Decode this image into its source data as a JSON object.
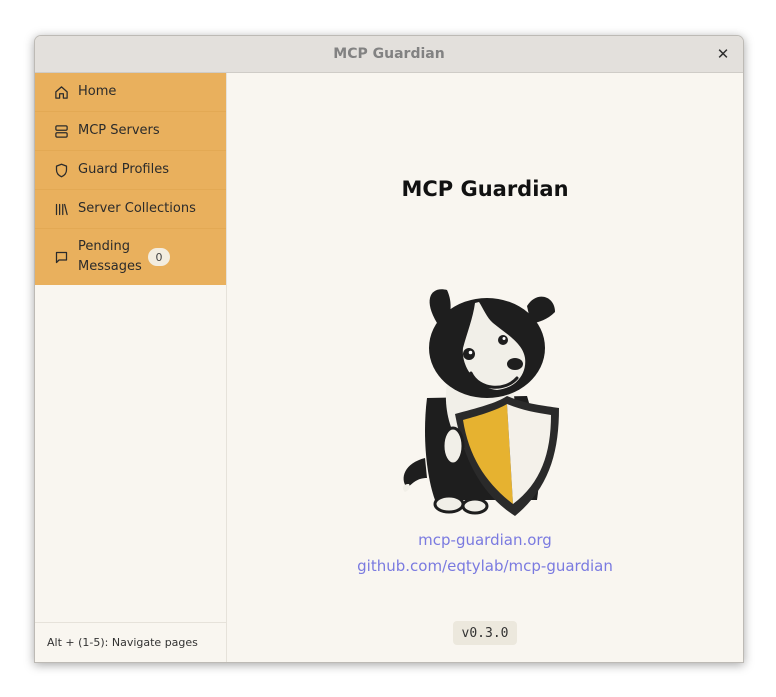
{
  "window": {
    "title": "MCP Guardian",
    "close_glyph": "✕"
  },
  "sidebar": {
    "items": [
      {
        "label": "Home",
        "icon": "home-icon"
      },
      {
        "label": "MCP Servers",
        "icon": "server-icon"
      },
      {
        "label": "Guard Profiles",
        "icon": "shield-icon"
      },
      {
        "label": "Server Collections",
        "icon": "library-icon"
      },
      {
        "label": "Pending Messages",
        "icon": "message-icon",
        "badge": "0"
      }
    ],
    "footer": "Alt + (1-5): Navigate pages"
  },
  "main": {
    "heading": "MCP Guardian",
    "mascot": "border-collie-with-shield",
    "website_link": "mcp-guardian.org",
    "github_link": "github.com/eqtylab/mcp-guardian",
    "version": "v0.3.0"
  },
  "colors": {
    "sidebar_accent": "#e9b05d",
    "link": "#7a7ae0",
    "background": "#f9f6f0"
  }
}
